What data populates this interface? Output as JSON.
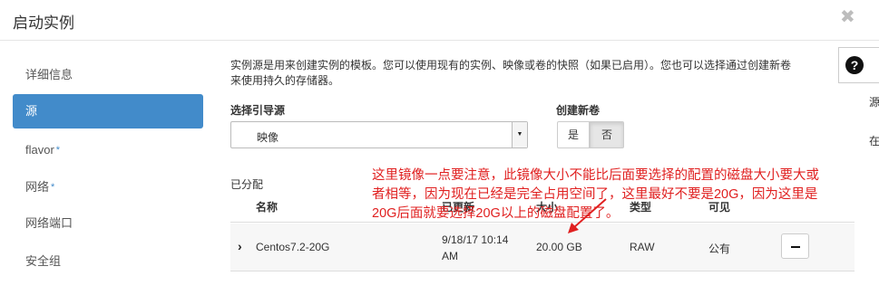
{
  "dialog": {
    "title": "启动实例",
    "close_glyph": "✖"
  },
  "sidebar": {
    "items": [
      {
        "label": "详细信息",
        "required": false
      },
      {
        "label": "源",
        "required": false,
        "active": true
      },
      {
        "label": "flavor",
        "required": true
      },
      {
        "label": "网络",
        "required": true
      },
      {
        "label": "网络端口",
        "required": false
      },
      {
        "label": "安全组",
        "required": false
      }
    ],
    "required_mark": "*"
  },
  "main": {
    "description_line1": "实例源是用来创建实例的模板。您可以使用现有的实例、映像或卷的快照（如果已启用）。您也可以选择通过创建新卷",
    "description_line2": "来使用持久的存储器。",
    "help_glyph": "?",
    "clipped_right_1": "源",
    "clipped_right_2": "在",
    "boot_source": {
      "label": "选择引导源",
      "value": "映像"
    },
    "create_volume": {
      "label": "创建新卷",
      "yes": "是",
      "no": "否",
      "selected": "否"
    },
    "allocated": {
      "label": "已分配",
      "columns": [
        "名称",
        "已更新",
        "大小",
        "类型",
        "可见"
      ],
      "rows": [
        {
          "name": "Centos7.2-20G",
          "updated_line1": "9/18/17 10:14",
          "updated_line2": "AM",
          "size": "20.00 GB",
          "type": "RAW",
          "visibility": "公有"
        }
      ]
    }
  },
  "annotation": {
    "line1": "这里镜像一点要注意，此镜像大小不能比后面要选择的配置的磁盘大小要大或",
    "line2": "者相等，因为现在已经是完全占用空间了，这里最好不要是20G，因为这里是",
    "line3": "20G后面就要选择20G以上的磁盘配置了。",
    "color": "#e02020"
  }
}
